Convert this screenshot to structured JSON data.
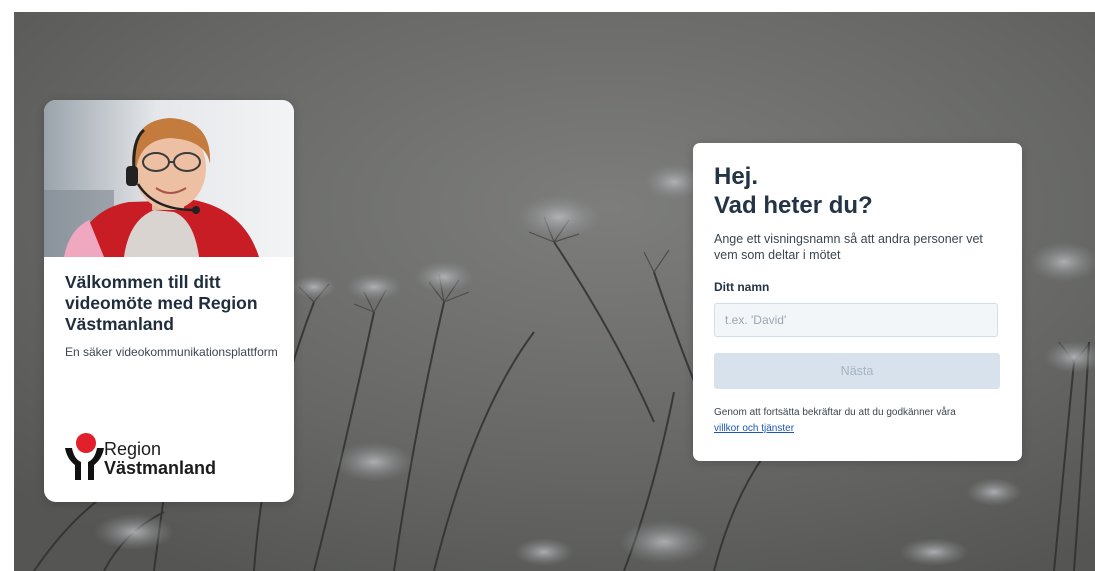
{
  "welcome": {
    "title": "Välkommen till ditt videomöte med Region Västmanland",
    "subtitle": "En säker videokommunikationsplattform",
    "photo_icon": "woman-with-headset-photo",
    "logo": {
      "line1": "Region",
      "line2": "Västmanland",
      "icon": "region-vastmanland-logo-icon"
    }
  },
  "login": {
    "title_line1": "Hej.",
    "title_line2": "Vad heter du?",
    "description": "Ange ett visningsnamn så att andra personer vet vem som deltar i mötet",
    "name_label": "Ditt namn",
    "name_placeholder": "t.ex. 'David'",
    "name_value": "",
    "next_label": "Nästa",
    "terms_text": "Genom att fortsätta bekräftar du att du godkänner våra",
    "terms_link": "villkor och tjänster"
  },
  "colors": {
    "background": "#6d6e6d",
    "title_text": "#243447",
    "button_disabled_bg": "#d7e2ec",
    "button_disabled_text": "#a6b4c2",
    "link": "#1c57b8",
    "logo_red": "#e2202b"
  }
}
